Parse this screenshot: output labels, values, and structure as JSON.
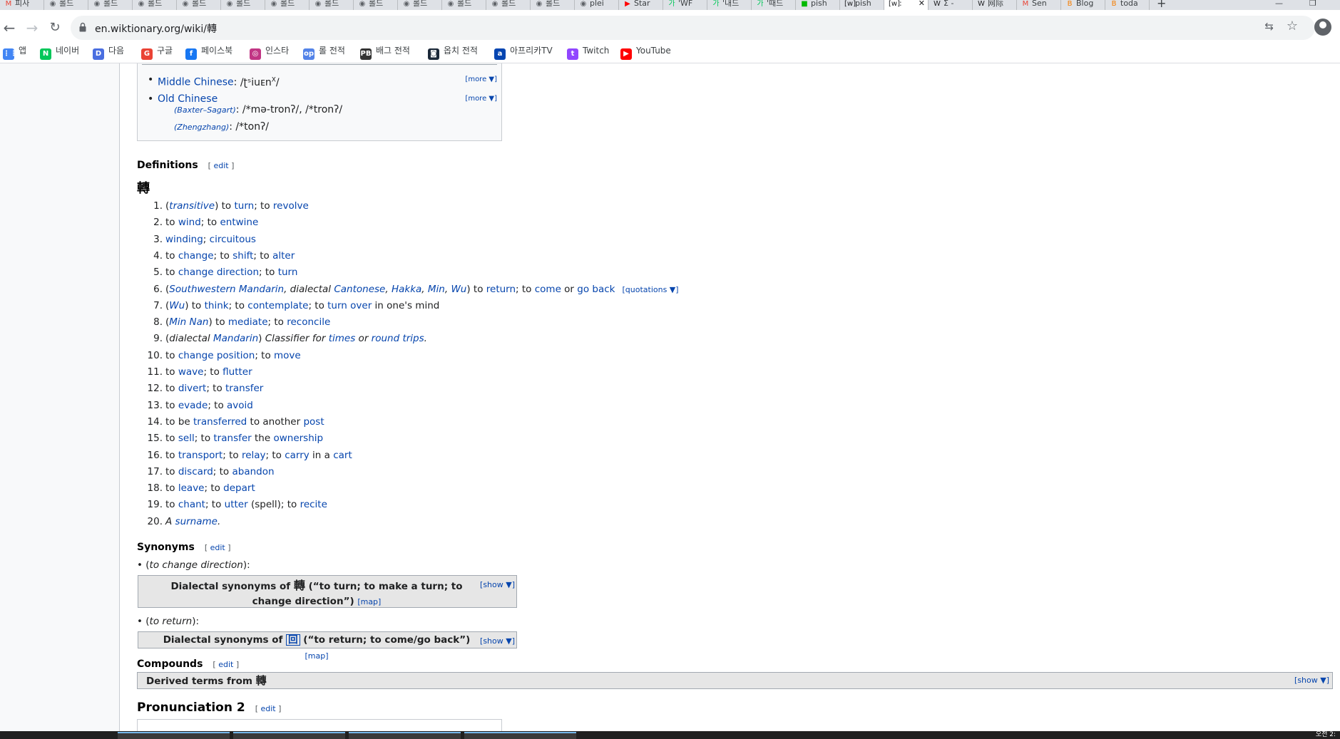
{
  "browser": {
    "tabs": [
      {
        "icon": "gmail-icon",
        "label": "피사"
      },
      {
        "icon": "globe-icon",
        "label": "롤드"
      },
      {
        "icon": "globe-icon",
        "label": "롤드"
      },
      {
        "icon": "globe-icon",
        "label": "롤드"
      },
      {
        "icon": "globe-icon",
        "label": "롤드"
      },
      {
        "icon": "globe-icon",
        "label": "롤드"
      },
      {
        "icon": "globe-icon",
        "label": "롤드"
      },
      {
        "icon": "globe-icon",
        "label": "롤드"
      },
      {
        "icon": "globe-icon",
        "label": "롤드"
      },
      {
        "icon": "globe-icon",
        "label": "롤드"
      },
      {
        "icon": "globe-icon",
        "label": "롤드"
      },
      {
        "icon": "globe-icon",
        "label": "롤드"
      },
      {
        "icon": "globe-icon",
        "label": "롤드"
      },
      {
        "icon": "globe-icon",
        "label": "plei"
      },
      {
        "icon": "youtube-icon",
        "label": "Star"
      },
      {
        "icon": "naver-icon",
        "label": "'WF"
      },
      {
        "icon": "naver-icon",
        "label": "'내드"
      },
      {
        "icon": "naver-icon",
        "label": "'때드"
      },
      {
        "icon": "line-icon",
        "label": "pish"
      },
      {
        "icon": "wiktionary-icon",
        "label": "pish"
      },
      {
        "icon": "wiktionary-icon",
        "label": ":"
      },
      {
        "icon": "wikipedia-icon",
        "label": "Σ -"
      },
      {
        "icon": "wikipedia-icon",
        "label": "网际"
      },
      {
        "icon": "gmail-icon",
        "label": "Sen"
      },
      {
        "icon": "blogger-icon",
        "label": "Blog"
      },
      {
        "icon": "blogger-icon",
        "label": "toda"
      }
    ],
    "url": "en.wiktionary.org/wiki/轉",
    "bookmarks": [
      {
        "label": "앱",
        "icon": "apps-grid-icon",
        "color": "#4285f4"
      },
      {
        "label": "네이버",
        "icon": "naver-icon",
        "color": "#03c75a"
      },
      {
        "label": "다음",
        "icon": "daum-icon",
        "color": "#4a6ee0"
      },
      {
        "label": "구글",
        "icon": "google-icon",
        "color": "#ea4335"
      },
      {
        "label": "페이스북",
        "icon": "facebook-icon",
        "color": "#1877f2"
      },
      {
        "label": "인스타",
        "icon": "instagram-icon",
        "color": "#c13584"
      },
      {
        "label": "롤 전적",
        "icon": "opgg-icon",
        "color": "#5383e8"
      },
      {
        "label": "배그 전적",
        "icon": "pubg-icon",
        "color": "#333333"
      },
      {
        "label": "옵치 전적",
        "icon": "overwatch-icon",
        "color": "#1b2838"
      },
      {
        "label": "아프리카TV",
        "icon": "afreecatv-icon",
        "color": "#0545b1"
      },
      {
        "label": "Twitch",
        "icon": "twitch-icon",
        "color": "#9146ff"
      },
      {
        "label": "YouTube",
        "icon": "youtube-icon",
        "color": "#ff0000"
      }
    ]
  },
  "pronunciation": {
    "middle_chinese": {
      "label": "Middle Chinese",
      "ipa": "/ʈˢiuᴇn",
      "ipa_sup": "X",
      "ipa_end": "/",
      "more": "[more ▼]"
    },
    "old_chinese": {
      "label": "Old Chinese",
      "more": "[more ▼]",
      "baxter_label": "(Baxter–Sagart)",
      "baxter_value": ": /*mə-tronʔ/, /*tronʔ/",
      "zheng_label": "(Zhengzhang)",
      "zheng_value": ": /*tonʔ/"
    }
  },
  "definitions": {
    "heading": "Definitions",
    "edit": "edit",
    "headword": "轉",
    "items": [
      [
        {
          "t": "("
        },
        {
          "b": "transitive",
          "i": 1
        },
        {
          "t": ") to "
        },
        {
          "b": "turn"
        },
        {
          "t": "; to "
        },
        {
          "b": "revolve"
        }
      ],
      [
        {
          "t": "to "
        },
        {
          "b": "wind"
        },
        {
          "t": "; to "
        },
        {
          "b": "entwine"
        }
      ],
      [
        {
          "b": "winding"
        },
        {
          "t": "; "
        },
        {
          "b": "circuitous"
        }
      ],
      [
        {
          "t": "to "
        },
        {
          "b": "change"
        },
        {
          "t": "; to "
        },
        {
          "b": "shift"
        },
        {
          "t": "; to "
        },
        {
          "b": "alter"
        }
      ],
      [
        {
          "t": "to "
        },
        {
          "b": "change direction"
        },
        {
          "t": "; to "
        },
        {
          "b": "turn"
        }
      ],
      [
        {
          "t": "("
        },
        {
          "b": "Southwestern Mandarin",
          "i": 1
        },
        {
          "t": ", dialectal ",
          "i": 1
        },
        {
          "b": "Cantonese",
          "i": 1
        },
        {
          "t": ", ",
          "i": 1
        },
        {
          "b": "Hakka",
          "i": 1
        },
        {
          "t": ", ",
          "i": 1
        },
        {
          "b": "Min",
          "i": 1
        },
        {
          "t": ", ",
          "i": 1
        },
        {
          "b": "Wu",
          "i": 1
        },
        {
          "t": ") to "
        },
        {
          "b": "return"
        },
        {
          "t": "; to "
        },
        {
          "b": "come"
        },
        {
          "t": " or "
        },
        {
          "b": "go back"
        },
        {
          "q": "[quotations ▼]"
        }
      ],
      [
        {
          "t": "("
        },
        {
          "b": "Wu",
          "i": 1
        },
        {
          "t": ") to "
        },
        {
          "b": "think"
        },
        {
          "t": "; to "
        },
        {
          "b": "contemplate"
        },
        {
          "t": "; to "
        },
        {
          "b": "turn over"
        },
        {
          "t": " in one's mind"
        }
      ],
      [
        {
          "t": "("
        },
        {
          "b": "Min Nan",
          "i": 1
        },
        {
          "t": ") to "
        },
        {
          "b": "mediate"
        },
        {
          "t": "; to "
        },
        {
          "b": "reconcile"
        }
      ],
      [
        {
          "t": "("
        },
        {
          "t": "dialectal ",
          "i": 1
        },
        {
          "b": "Mandarin",
          "i": 1
        },
        {
          "t": ") "
        },
        {
          "t": "Classifier for ",
          "i": 1
        },
        {
          "b": "times",
          "i": 1
        },
        {
          "t": " or ",
          "i": 1
        },
        {
          "b": "round trips",
          "i": 1
        },
        {
          "t": ".",
          "i": 1
        }
      ],
      [
        {
          "t": "to "
        },
        {
          "b": "change position"
        },
        {
          "t": "; to "
        },
        {
          "b": "move"
        }
      ],
      [
        {
          "t": "to "
        },
        {
          "b": "wave"
        },
        {
          "t": "; to "
        },
        {
          "b": "flutter"
        }
      ],
      [
        {
          "t": "to "
        },
        {
          "b": "divert"
        },
        {
          "t": "; to "
        },
        {
          "b": "transfer"
        }
      ],
      [
        {
          "t": "to "
        },
        {
          "b": "evade"
        },
        {
          "t": "; to "
        },
        {
          "b": "avoid"
        }
      ],
      [
        {
          "t": "to be "
        },
        {
          "b": "transferred"
        },
        {
          "t": " to another "
        },
        {
          "b": "post"
        }
      ],
      [
        {
          "t": "to "
        },
        {
          "b": "sell"
        },
        {
          "t": "; to "
        },
        {
          "b": "transfer"
        },
        {
          "t": " the "
        },
        {
          "b": "ownership"
        }
      ],
      [
        {
          "t": "to "
        },
        {
          "b": "transport"
        },
        {
          "t": "; to "
        },
        {
          "b": "relay"
        },
        {
          "t": "; to "
        },
        {
          "b": "carry"
        },
        {
          "t": " in a "
        },
        {
          "b": "cart"
        }
      ],
      [
        {
          "t": "to "
        },
        {
          "b": "discard"
        },
        {
          "t": "; to "
        },
        {
          "b": "abandon"
        }
      ],
      [
        {
          "t": "to "
        },
        {
          "b": "leave"
        },
        {
          "t": "; to "
        },
        {
          "b": "depart"
        }
      ],
      [
        {
          "t": "to "
        },
        {
          "b": "chant"
        },
        {
          "t": "; to "
        },
        {
          "b": "utter"
        },
        {
          "t": " (spell); to "
        },
        {
          "b": "recite"
        }
      ],
      [
        {
          "t": "A ",
          "i": 1
        },
        {
          "b": "surname",
          "i": 1
        },
        {
          "t": ".",
          "i": 1
        }
      ]
    ]
  },
  "synonyms": {
    "heading": "Synonyms",
    "edit": "edit",
    "groups": [
      {
        "caption": "to change direction",
        "box_prefix": "Dialectal synonyms of ",
        "han": "轉",
        "box_gloss": " (“to turn; to make a turn; to change direction”) ",
        "map": "[map]",
        "show": "[show ▼]"
      },
      {
        "caption": "to return",
        "box_prefix": "Dialectal synonyms of ",
        "han": "回",
        "box_gloss": " (“to return; to come/go back”) ",
        "map": "[map]",
        "show": "[show ▼]"
      }
    ]
  },
  "compounds": {
    "heading": "Compounds",
    "edit": "edit",
    "derived_label": "Derived terms from ",
    "derived_han": "轉",
    "show": "[show ▼]"
  },
  "pronunciation2": {
    "heading": "Pronunciation 2",
    "edit": "edit"
  },
  "taskbar": {
    "clock": "오전 2:"
  }
}
